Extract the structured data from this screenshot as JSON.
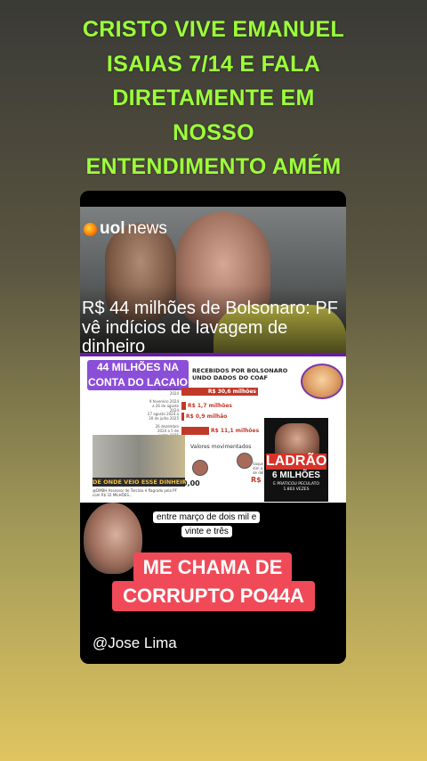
{
  "headline": {
    "lines": [
      "CRISTO VIVE EMANUEL",
      "ISAIAS 7/14 E FALA",
      "DIRETAMENTE EM",
      "NOSSO",
      "ENTENDIMENTO AMÉM"
    ]
  },
  "video": {
    "logo_brand": "uol",
    "logo_suffix": "news",
    "title": "R$ 44 milhões de Bolsonaro: PF vê indícios de lavagem de dinheiro",
    "infographic": {
      "label_line1": "44 MILHÕES NA",
      "label_line2": "CONTA DO LACAIO",
      "header_line1": "RECEBIDOS POR BOLSONARO",
      "header_line2": "UNDO DADOS DO COAF",
      "bars": [
        {
          "date": "7 de fevereiro 2024",
          "amount": "R$ 30,6 milhões",
          "fill": 0.72
        },
        {
          "date": "9 fevereiro 2024 a 26 de agosto 2024",
          "amount": "R$ 1,7 milhões",
          "fill": 0.04
        },
        {
          "date": "27 agosto 2024 a 30 de julho 2025",
          "amount": "R$ 0,9 milhão",
          "fill": 0.02
        },
        {
          "date": "26 dezembro 2024 a 5 de junho 2025",
          "amount": "R$ 11,1 milhões",
          "fill": 0.26
        }
      ],
      "valores_label": "Valores movimentados",
      "value_left": "0,00",
      "value_right": "R$ 236.70",
      "saque_note": "Saque em dim a cartão de débito",
      "strip_caption": "DE ONDE VEIO ESSE DINHEIRO",
      "mini_note": "@DMBH Assessor de Tarcísio é flagrado pela PF com R$ 32 MILHÕES..."
    },
    "cover": {
      "title": "LADRÃO",
      "subtitle": "6 MILHÕES",
      "line2": "E PRATICOU PECULATO",
      "line3": "1.803 VEZES"
    },
    "subtitle_line1": "entre março de dois mil e",
    "subtitle_line2": "vinte e três",
    "red_line1": "ME CHAMA DE",
    "red_line2": "CORRUPTO PO44A",
    "handle": "@Jose Lima"
  },
  "colors": {
    "headline": "#9cff3a",
    "red_label": "#f04a58",
    "purple": "#8a4ed8",
    "bar": "#c03a2a"
  }
}
